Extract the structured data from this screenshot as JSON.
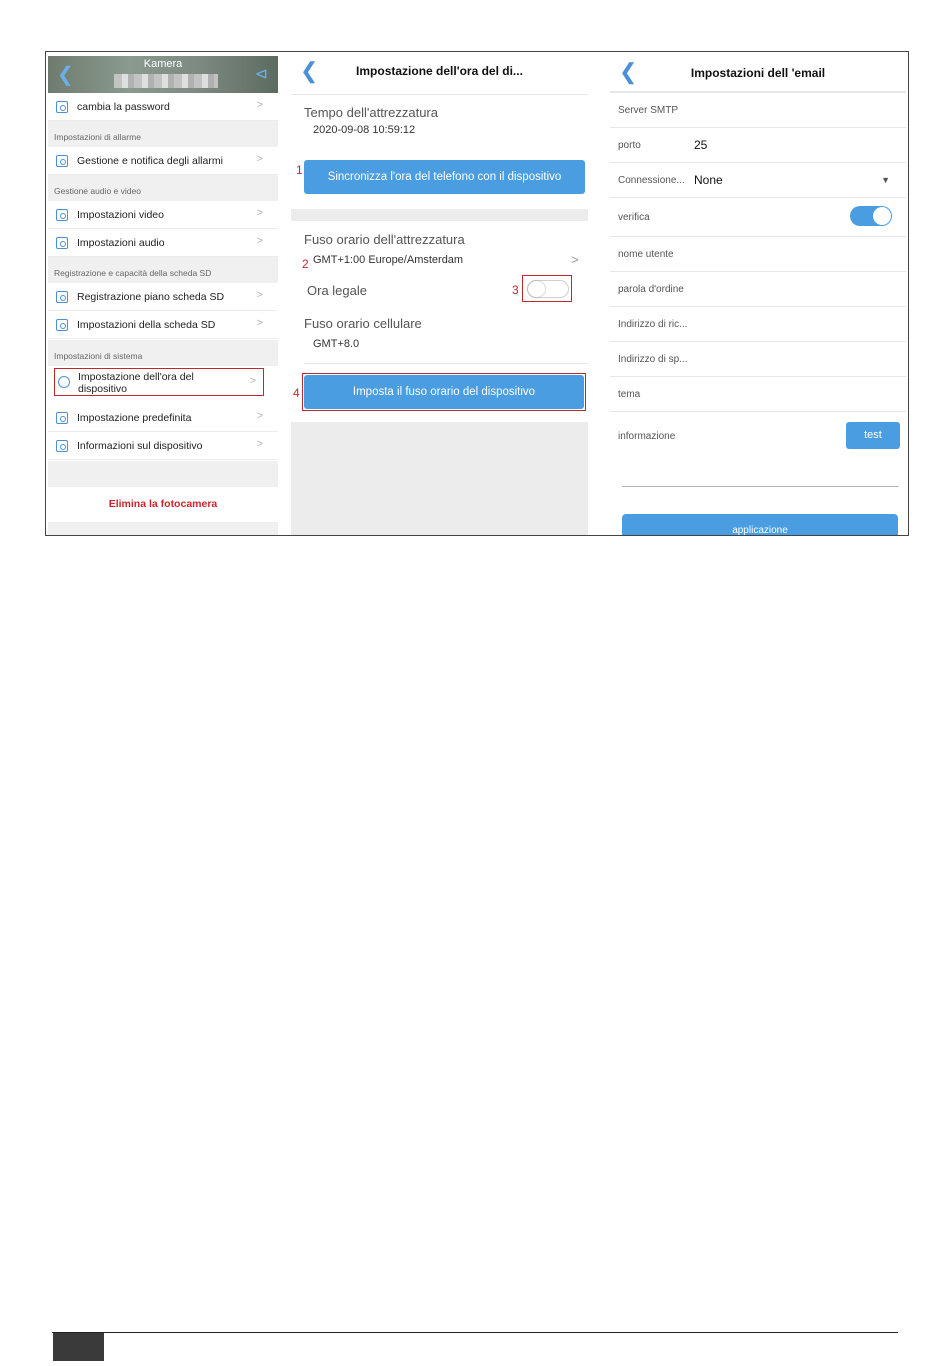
{
  "panel1": {
    "header_title": "Kamera",
    "rows": [
      {
        "label": "cambia la password"
      },
      {
        "label": "Gestione e notifica degli allarmi"
      },
      {
        "label": "Impostazioni video"
      },
      {
        "label": "Impostazioni audio"
      },
      {
        "label": "Registrazione piano scheda SD"
      },
      {
        "label": "Impostazioni della scheda SD"
      },
      {
        "label": "Impostazione dell'ora del dispositivo"
      },
      {
        "label": "Impostazione predefinita"
      },
      {
        "label": "Informazioni sul dispositivo"
      }
    ],
    "sections": [
      "Impostazioni di allarme",
      "Gestione audio e video",
      "Registrazione e capacità della scheda SD",
      "Impostazioni di sistema"
    ],
    "delete_label": "Elimina la fotocamera",
    "chevron": ">"
  },
  "panel2": {
    "title": "Impostazione dell'ora del di...",
    "device_time_label": "Tempo dell'attrezzatura",
    "device_time_value": "2020-09-08 10:59:12",
    "sync_button": "Sincronizza l'ora del telefono con il dispositivo",
    "device_tz_label": "Fuso orario dell'attrezzatura",
    "device_tz_value": "GMT+1:00 Europe/Amsterdam",
    "dst_label": "Ora legale",
    "dst_enabled": false,
    "phone_tz_label": "Fuso orario cellulare",
    "phone_tz_value": "GMT+8.0",
    "set_tz_button": "Imposta il fuso orario del dispositivo",
    "markers": [
      "1",
      "2",
      "3",
      "4"
    ],
    "chevron": ">"
  },
  "panel3": {
    "title": "Impostazioni dell 'email",
    "fields": {
      "smtp_label": "Server SMTP",
      "port_label": "porto",
      "port_value": "25",
      "connection_label": "Connessione...",
      "connection_value": "None",
      "verify_label": "verifica",
      "verify_enabled": true,
      "username_label": "nome utente",
      "password_label": "parola d'ordine",
      "recipient_label": "Indirizzo di ric...",
      "sender_label": "Indirizzo di sp...",
      "subject_label": "tema",
      "info_label": "informazione"
    },
    "test_button": "test",
    "apply_button": "applicazione"
  },
  "colors": {
    "accent": "#4a9de0",
    "highlight_border": "#c0282d",
    "danger_text": "#d0242b"
  }
}
